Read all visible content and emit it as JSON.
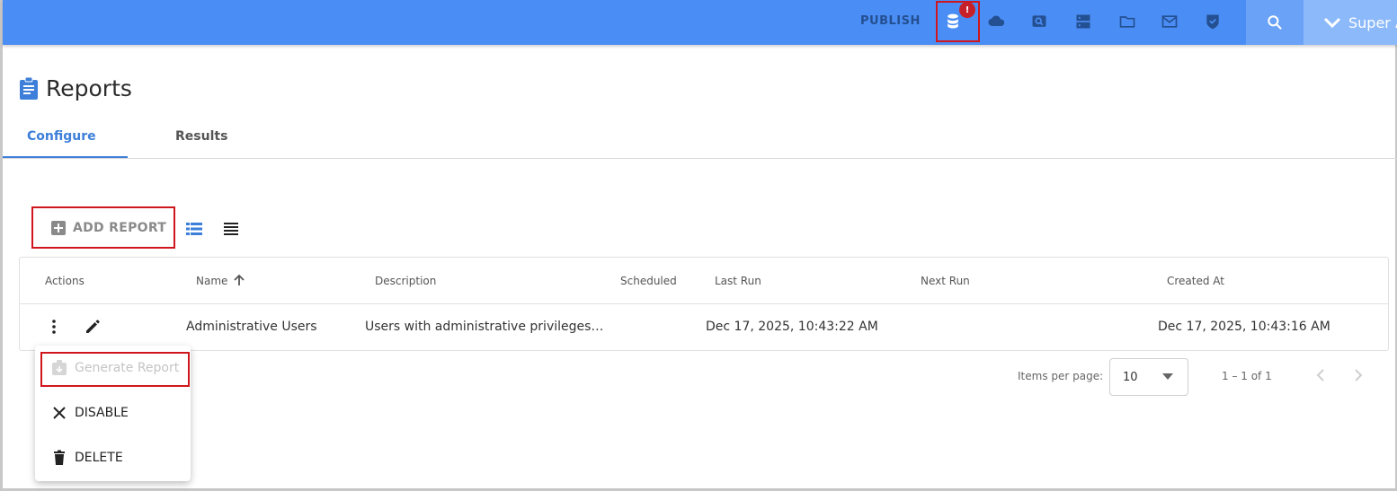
{
  "topbar": {
    "publish_label": "PUBLISH",
    "db_badge": "!",
    "user_label": "Super A",
    "icons": [
      "database-icon",
      "cloud-icon",
      "search-screen-icon",
      "server-icon",
      "folder-icon",
      "mail-icon",
      "shield-check-icon",
      "search-icon",
      "chevron-down-icon"
    ],
    "bar_color": "#4a8ef5"
  },
  "page": {
    "title": "Reports"
  },
  "tabs": [
    {
      "label": "Configure",
      "active": true
    },
    {
      "label": "Results",
      "active": false
    }
  ],
  "toolbar": {
    "add_report_label": "ADD REPORT"
  },
  "table": {
    "columns": [
      "Actions",
      "Name",
      "Description",
      "Scheduled",
      "Last Run",
      "Next Run",
      "Created At"
    ],
    "rows": [
      {
        "name": "Administrative Users",
        "description": "Users with administrative privileges…",
        "scheduled": "",
        "last_run": "Dec 17, 2025, 10:43:22 AM",
        "next_run": "",
        "created_at": "Dec 17, 2025, 10:43:16 AM"
      }
    ]
  },
  "action_menu": {
    "items": [
      "Generate Report",
      "DISABLE",
      "DELETE"
    ]
  },
  "paginator": {
    "items_per_page_label": "Items per page:",
    "page_size": "10",
    "range": "1 – 1 of 1"
  }
}
